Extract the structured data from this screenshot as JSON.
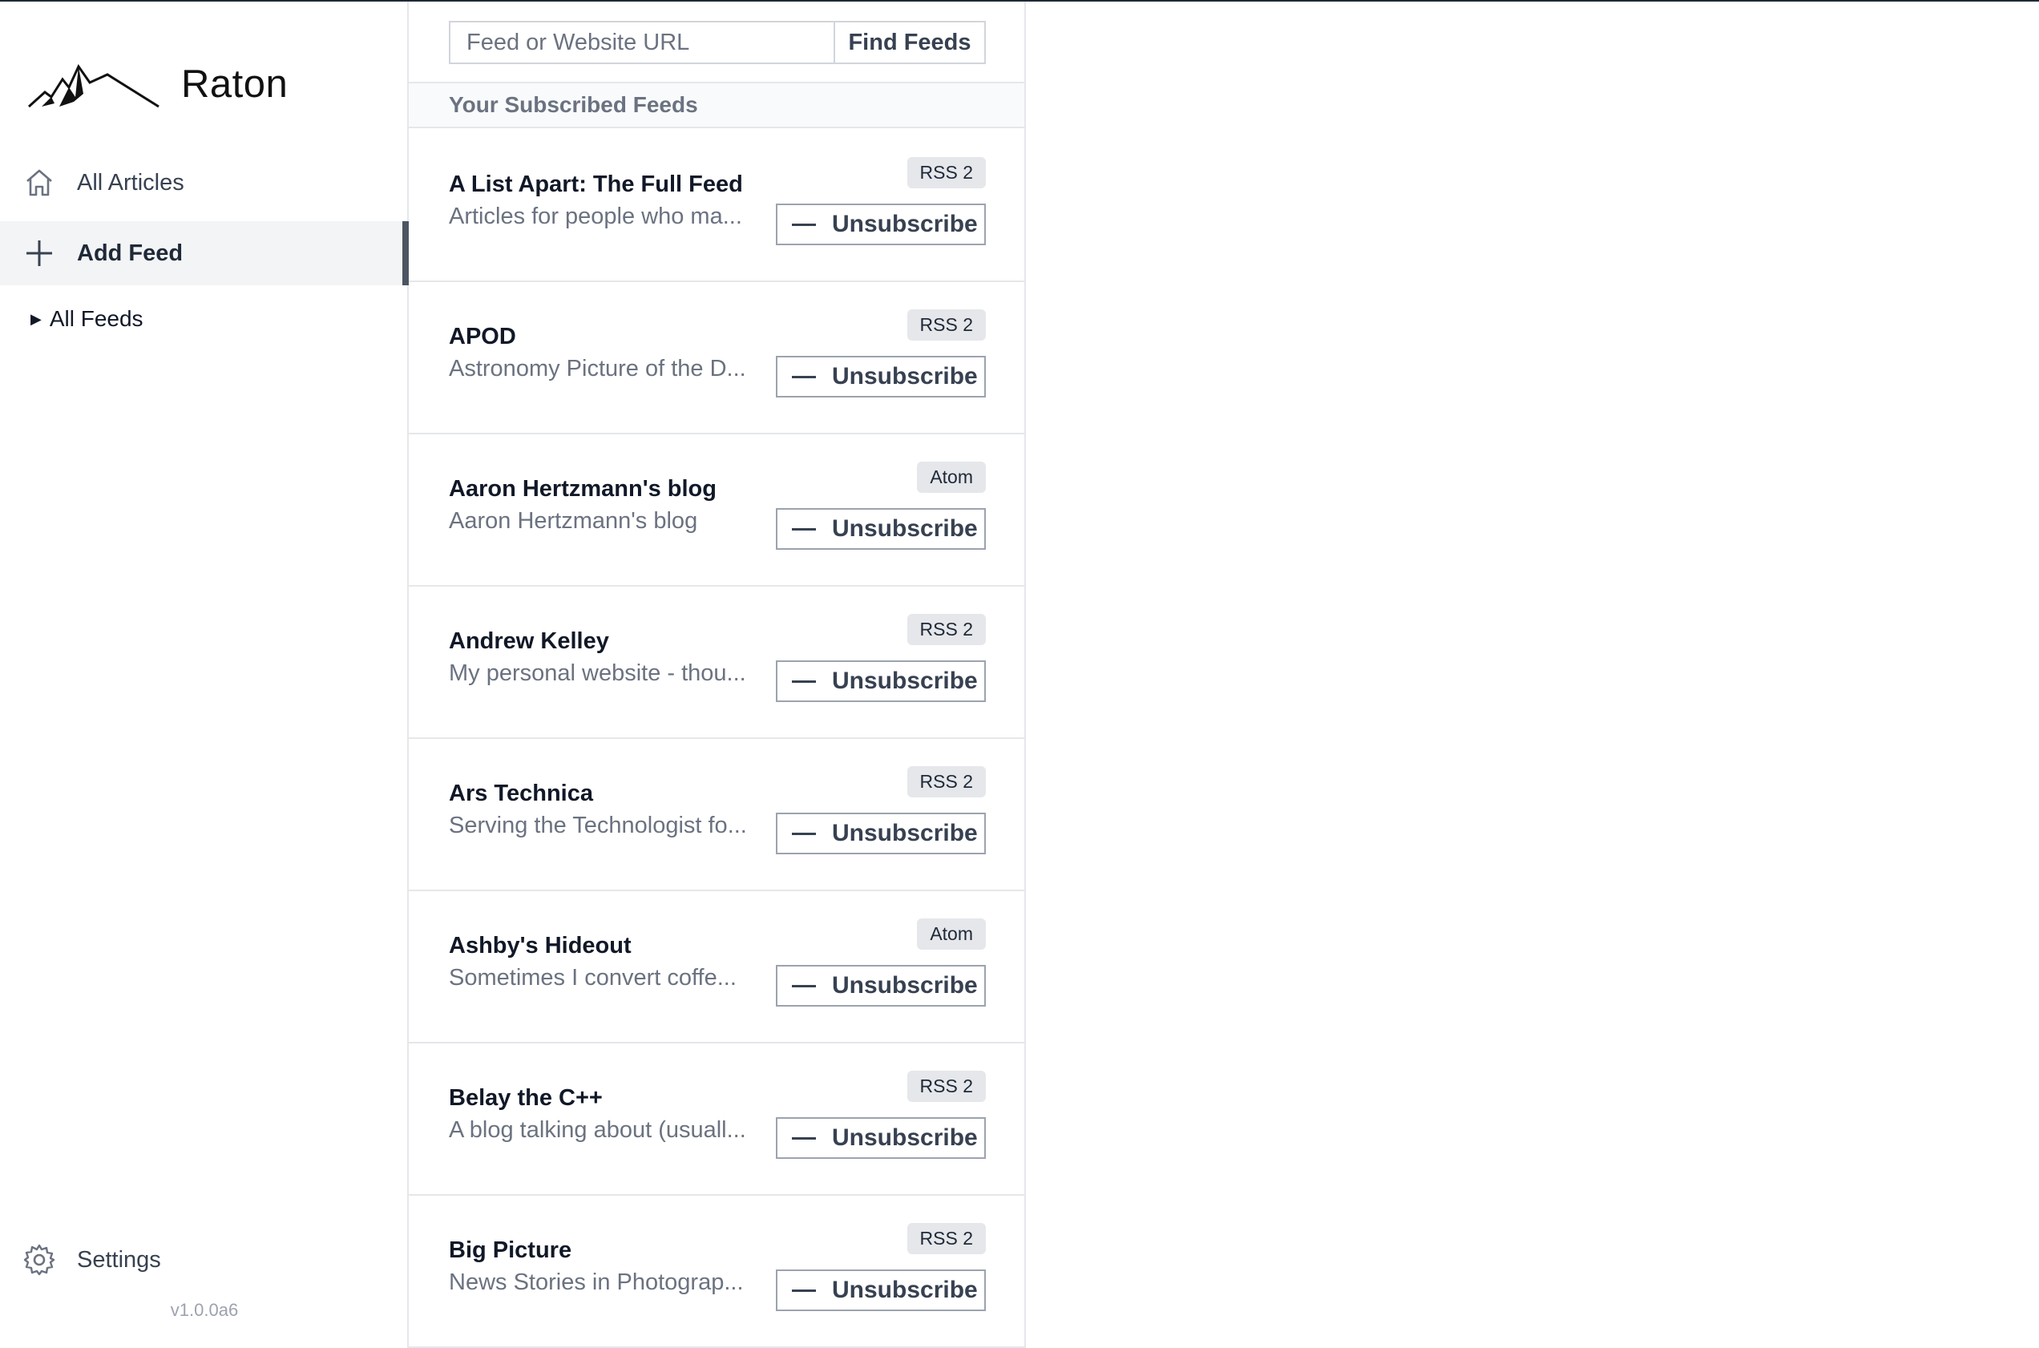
{
  "app": {
    "name": "Raton",
    "version": "v1.0.0a6"
  },
  "sidebar": {
    "items": [
      {
        "label": "All Articles",
        "icon": "home-icon"
      },
      {
        "label": "Add Feed",
        "icon": "plus-icon",
        "active": true
      }
    ],
    "feeds_toggle": "All Feeds",
    "settings_label": "Settings"
  },
  "search": {
    "placeholder": "Feed or Website URL",
    "value": "",
    "button_label": "Find Feeds"
  },
  "section": {
    "title": "Your Subscribed Feeds"
  },
  "unsubscribe_label": "Unsubscribe",
  "feeds": [
    {
      "title": "A List Apart: The Full Feed",
      "description": "Articles for people who ma...",
      "type": "RSS 2"
    },
    {
      "title": "APOD",
      "description": "Astronomy Picture of the D...",
      "type": "RSS 2"
    },
    {
      "title": "Aaron Hertzmann's blog",
      "description": "Aaron Hertzmann's blog",
      "type": "Atom"
    },
    {
      "title": "Andrew Kelley",
      "description": "My personal website - thou...",
      "type": "RSS 2"
    },
    {
      "title": "Ars Technica",
      "description": "Serving the Technologist fo...",
      "type": "RSS 2"
    },
    {
      "title": "Ashby's Hideout",
      "description": "Sometimes I convert coffe...",
      "type": "Atom"
    },
    {
      "title": "Belay the C++",
      "description": "A blog talking about (usuall...",
      "type": "RSS 2"
    },
    {
      "title": "Big Picture",
      "description": "News Stories in Photograp...",
      "type": "RSS 2"
    }
  ],
  "colors": {
    "active_indicator": "#4b5563",
    "badge_bg": "#e5e7eb",
    "muted_text": "#6b7280"
  }
}
